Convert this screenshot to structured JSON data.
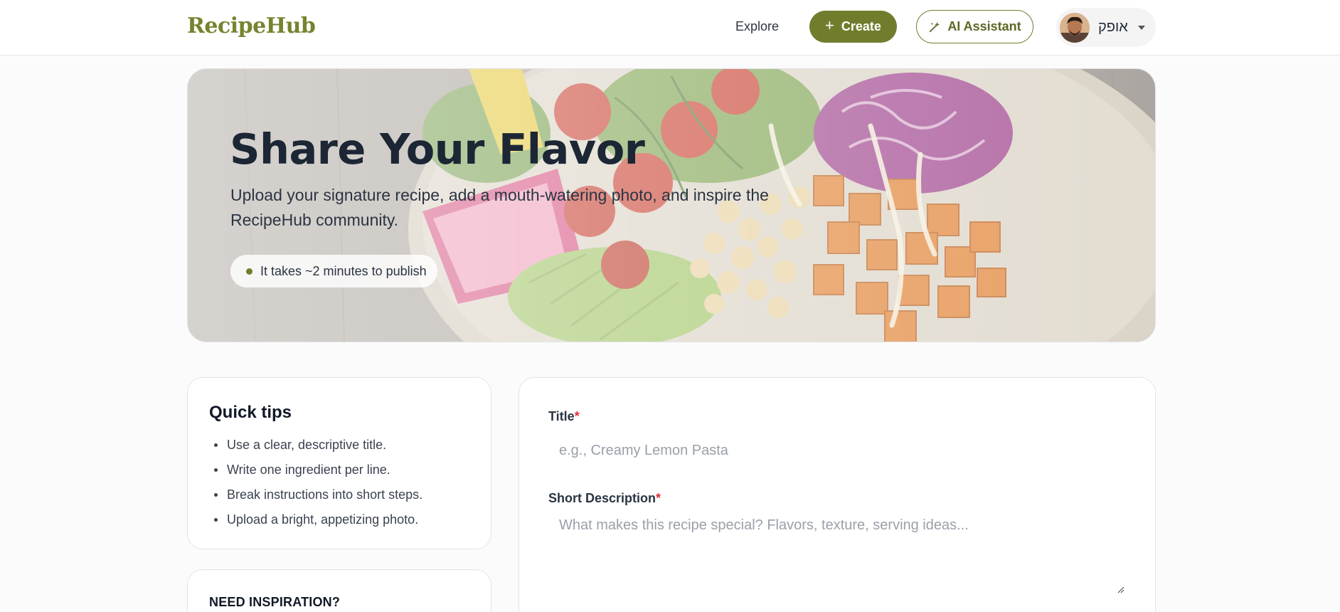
{
  "brand": {
    "name": "RecipeHub",
    "accent": "#717d2d"
  },
  "nav": {
    "explore_label": "Explore",
    "create_label": "Create",
    "create_icon": "plus-icon",
    "ai_label": "AI Assistant",
    "ai_icon": "magic-wand-icon",
    "user_name": "אופק",
    "user_caret_icon": "caret-down-icon"
  },
  "hero": {
    "title": "Share Your Flavor",
    "subtitle": "Upload your signature recipe, add a mouth-watering photo, and inspire the RecipeHub community.",
    "pill_text": "It takes ~2 minutes to publish"
  },
  "tips": {
    "title": "Quick tips",
    "items": [
      "Use a clear, descriptive title.",
      "Write one ingredient per line.",
      "Break instructions into short steps.",
      "Upload a bright, appetizing photo."
    ]
  },
  "inspiration": {
    "title": "NEED INSPIRATION?"
  },
  "form": {
    "title_label": "Title",
    "title_required": "*",
    "title_placeholder": "e.g., Creamy Lemon Pasta",
    "title_value": "",
    "description_label": "Short Description",
    "description_required": "*",
    "description_placeholder": "What makes this recipe special? Flavors, texture, serving ideas...",
    "description_value": ""
  }
}
